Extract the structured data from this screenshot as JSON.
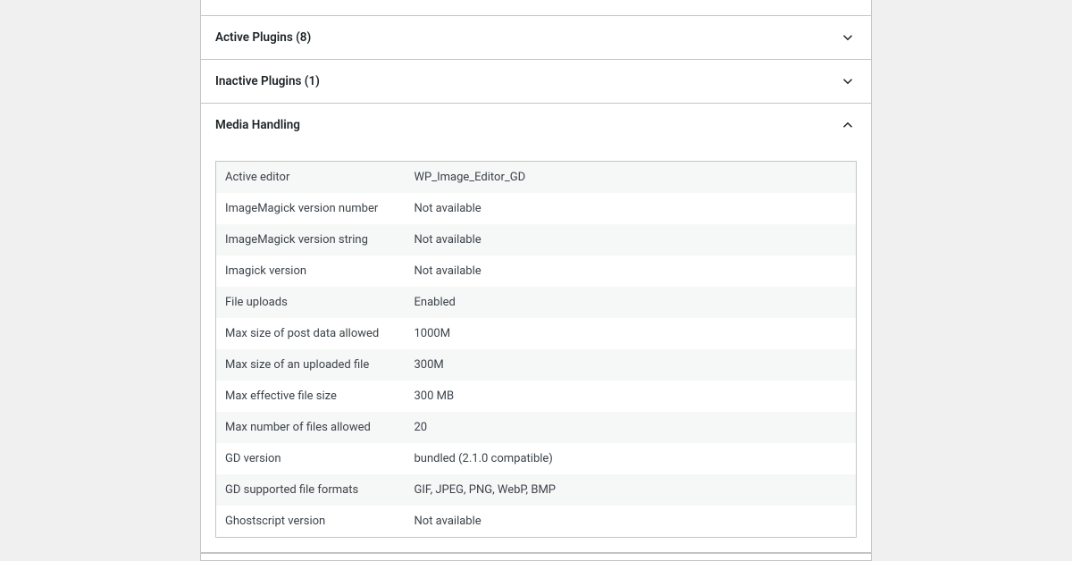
{
  "panels": {
    "active_plugins": {
      "title": "Active Plugins (8)"
    },
    "inactive_plugins": {
      "title": "Inactive Plugins (1)"
    },
    "media_handling": {
      "title": "Media Handling"
    }
  },
  "media_rows": [
    {
      "key": "Active editor",
      "value": "WP_Image_Editor_GD"
    },
    {
      "key": "ImageMagick version number",
      "value": "Not available"
    },
    {
      "key": "ImageMagick version string",
      "value": "Not available"
    },
    {
      "key": "Imagick version",
      "value": "Not available"
    },
    {
      "key": "File uploads",
      "value": "Enabled"
    },
    {
      "key": "Max size of post data allowed",
      "value": "1000M"
    },
    {
      "key": "Max size of an uploaded file",
      "value": "300M"
    },
    {
      "key": "Max effective file size",
      "value": "300 MB"
    },
    {
      "key": "Max number of files allowed",
      "value": "20"
    },
    {
      "key": "GD version",
      "value": "bundled (2.1.0 compatible)"
    },
    {
      "key": "GD supported file formats",
      "value": "GIF, JPEG, PNG, WebP, BMP"
    },
    {
      "key": "Ghostscript version",
      "value": "Not available"
    }
  ]
}
